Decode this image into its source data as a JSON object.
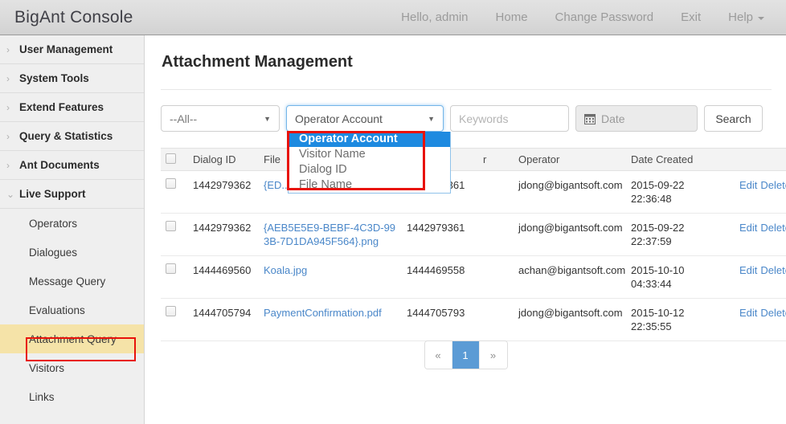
{
  "app": {
    "brand": "BigAnt Console"
  },
  "topnav": {
    "items": [
      {
        "label": "Hello, admin",
        "name": "greeting"
      },
      {
        "label": "Home",
        "name": "home"
      },
      {
        "label": "Change Password",
        "name": "change-password"
      },
      {
        "label": "Exit",
        "name": "exit"
      },
      {
        "label": "Help",
        "name": "help",
        "caret": true
      }
    ]
  },
  "sidebar": {
    "groups": [
      {
        "label": "User Management",
        "expanded": false
      },
      {
        "label": "System Tools",
        "expanded": false
      },
      {
        "label": "Extend Features",
        "expanded": false
      },
      {
        "label": "Query & Statistics",
        "expanded": false
      },
      {
        "label": "Ant Documents",
        "expanded": false
      },
      {
        "label": "Live Support",
        "expanded": true
      }
    ],
    "subitems": [
      {
        "label": "Operators",
        "active": false
      },
      {
        "label": "Dialogues",
        "active": false
      },
      {
        "label": "Message Query",
        "active": false
      },
      {
        "label": "Evaluations",
        "active": false
      },
      {
        "label": "Attachment Query",
        "active": true
      },
      {
        "label": "Visitors",
        "active": false
      },
      {
        "label": "Links",
        "active": false
      }
    ]
  },
  "main": {
    "title": "Attachment Management"
  },
  "filters": {
    "scope_select": {
      "value": "--All--"
    },
    "field_select": {
      "value": "Operator Account",
      "open": true,
      "options": [
        "Operator Account",
        "Visitor Name",
        "Dialog ID",
        "File Name"
      ],
      "selected_index": 0
    },
    "keywords_input": {
      "value": "",
      "placeholder": "Keywords"
    },
    "date_input": {
      "value": "",
      "placeholder": "Date",
      "icon": "calendar-icon"
    },
    "search_button": {
      "label": "Search"
    }
  },
  "table": {
    "columns": [
      {
        "key": "chk",
        "label": ""
      },
      {
        "key": "dialog_id",
        "label": "Dialog ID"
      },
      {
        "key": "file_name",
        "label": "File"
      },
      {
        "key": "visitor_id",
        "label": ""
      },
      {
        "key": "visitor_name",
        "label": "r"
      },
      {
        "key": "operator",
        "label": "Operator"
      },
      {
        "key": "date_created",
        "label": "Date Created"
      },
      {
        "key": "actions",
        "label": ""
      }
    ],
    "rows": [
      {
        "dialog_id": "1442979362",
        "file_name": "{ED...A75...}.png",
        "visitor_id": "1442979361",
        "visitor_name": "",
        "operator": "jdong@bigantsoft.com",
        "date_created": "2015-09-22 22:36:48",
        "edit": "Edit",
        "delete": "Delete"
      },
      {
        "dialog_id": "1442979362",
        "file_name": "{AEB5E5E9-BEBF-4C3D-993B-7D1DA945F564}.png",
        "visitor_id": "1442979361",
        "visitor_name": "",
        "operator": "jdong@bigantsoft.com",
        "date_created": "2015-09-22 22:37:59",
        "edit": "Edit",
        "delete": "Delete"
      },
      {
        "dialog_id": "1444469560",
        "file_name": "Koala.jpg",
        "visitor_id": "1444469558",
        "visitor_name": "",
        "operator": "achan@bigantsoft.com",
        "date_created": "2015-10-10 04:33:44",
        "edit": "Edit",
        "delete": "Delete"
      },
      {
        "dialog_id": "1444705794",
        "file_name": "PaymentConfirmation.pdf",
        "visitor_id": "1444705793",
        "visitor_name": "",
        "operator": "jdong@bigantsoft.com",
        "date_created": "2015-10-12 22:35:55",
        "edit": "Edit",
        "delete": "Delete"
      }
    ]
  },
  "pagination": {
    "prev": "«",
    "next": "»",
    "pages": [
      "1"
    ],
    "current": "1"
  },
  "annotations": {
    "highlight_color": "#e8120a"
  }
}
